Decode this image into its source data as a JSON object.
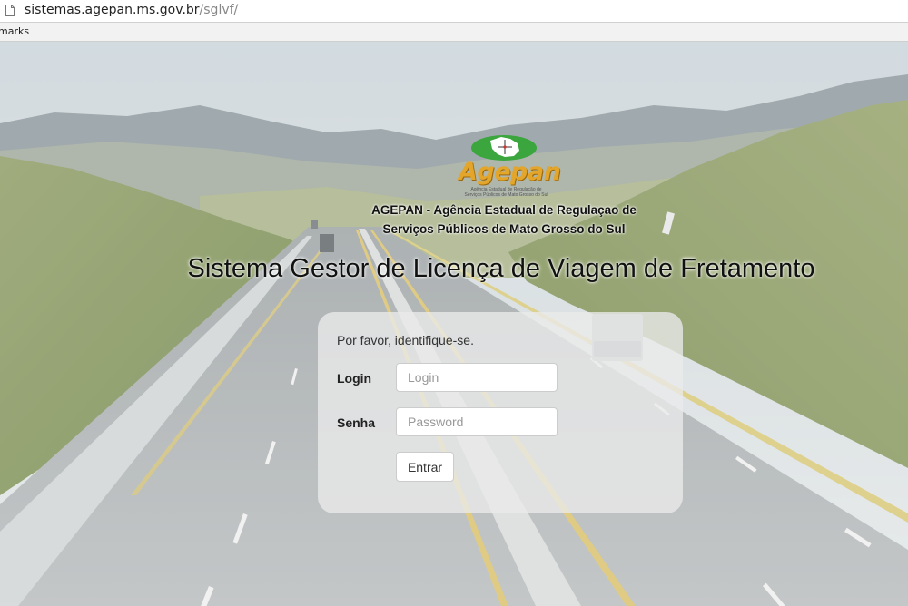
{
  "browser": {
    "url_host": "sistemas.agepan.ms.gov.br",
    "url_path": "/sglvf/",
    "bookmarks_label": "marks",
    "page_icon": "page-icon"
  },
  "logo": {
    "brand": "Agepan",
    "subtitle": "Agência Estadual de Regulação de Serviços Públicos de Mato Grosso do Sul",
    "colors": {
      "brand_orange": "#e3a52a",
      "oval_green": "#3aa63d",
      "map_white": "#ffffff"
    }
  },
  "agency": {
    "line1": "AGEPAN - Agência Estadual de Regulaçao de",
    "line2": "Serviços Públicos de Mato Grosso do Sul"
  },
  "system_title": "Sistema Gestor de Licença de Viagem de Fretamento",
  "login_form": {
    "prompt": "Por favor, identifique-se.",
    "login_label": "Login",
    "login_placeholder": "Login",
    "password_label": "Senha",
    "password_placeholder": "Password",
    "submit_label": "Entrar"
  }
}
